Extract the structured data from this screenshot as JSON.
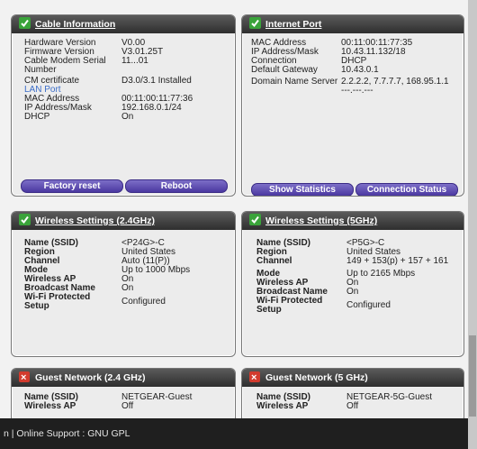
{
  "cable_info": {
    "title": "Cable Information",
    "rows": [
      {
        "label": "Hardware Version",
        "value": "V0.00"
      },
      {
        "label": "Firmware Version",
        "value": "V3.01.25T"
      },
      {
        "label": "Cable Modem Serial Number",
        "value": "11...01"
      },
      {
        "label": "CM certificate",
        "value": "D3.0/3.1 Installed"
      },
      {
        "label": "LAN Port",
        "value": ""
      },
      {
        "label": "MAC Address",
        "value": "00:11:00:11:77:36"
      },
      {
        "label": "IP Address/Mask",
        "value": "192.168.0.1/24"
      },
      {
        "label": "DHCP",
        "value": "On"
      }
    ],
    "buttons": {
      "factory_reset": "Factory reset",
      "reboot": "Reboot"
    }
  },
  "internet_port": {
    "title": "Internet Port",
    "rows": [
      {
        "label": "MAC Address",
        "value": "00:11:00:11:77:35"
      },
      {
        "label": "IP Address/Mask",
        "value": "10.43.11.132/18"
      },
      {
        "label": "Connection",
        "value": "DHCP"
      },
      {
        "label": "Default Gateway",
        "value": "10.43.0.1"
      },
      {
        "label": "Domain Name Server",
        "value": "2.2.2.2, 7.7.7.7, 168.95.1.1"
      },
      {
        "label": "",
        "value": "---.---.---"
      }
    ],
    "buttons": {
      "show_statistics": "Show Statistics",
      "connection_status": "Connection Status"
    }
  },
  "wireless_24": {
    "title": "Wireless Settings (2.4GHz)",
    "rows": [
      {
        "label": "Name (SSID)",
        "value": "<P24G>-C"
      },
      {
        "label": "Region",
        "value": "United States"
      },
      {
        "label": "Channel",
        "value": "Auto (11(P))"
      },
      {
        "label": "Mode",
        "value": "Up to 1000 Mbps"
      },
      {
        "label": "Wireless AP",
        "value": "On"
      },
      {
        "label": "Broadcast Name",
        "value": "On"
      },
      {
        "label": "Wi-Fi Protected Setup",
        "value": "Configured"
      }
    ]
  },
  "wireless_5": {
    "title": "Wireless Settings (5GHz)",
    "rows": [
      {
        "label": "Name (SSID)",
        "value": "<P5G>-C"
      },
      {
        "label": "Region",
        "value": "United States"
      },
      {
        "label": "Channel",
        "value": "149 + 153(p) + 157 + 161"
      },
      {
        "label": "Mode",
        "value": "Up to 2165 Mbps"
      },
      {
        "label": "Wireless AP",
        "value": "On"
      },
      {
        "label": "Broadcast Name",
        "value": "On"
      },
      {
        "label": "Wi-Fi Protected Setup",
        "value": "Configured"
      }
    ]
  },
  "guest_24": {
    "title": "Guest Network (2.4 GHz)",
    "rows": [
      {
        "label": "Name (SSID)",
        "value": "NETGEAR-Guest"
      },
      {
        "label": "Wireless AP",
        "value": "Off"
      }
    ]
  },
  "guest_5": {
    "title": "Guest Network (5 GHz)",
    "rows": [
      {
        "label": "Name (SSID)",
        "value": "NETGEAR-5G-Guest"
      },
      {
        "label": "Wireless AP",
        "value": "Off"
      }
    ]
  },
  "footer": {
    "text": "n | Online Support : GNU GPL"
  }
}
